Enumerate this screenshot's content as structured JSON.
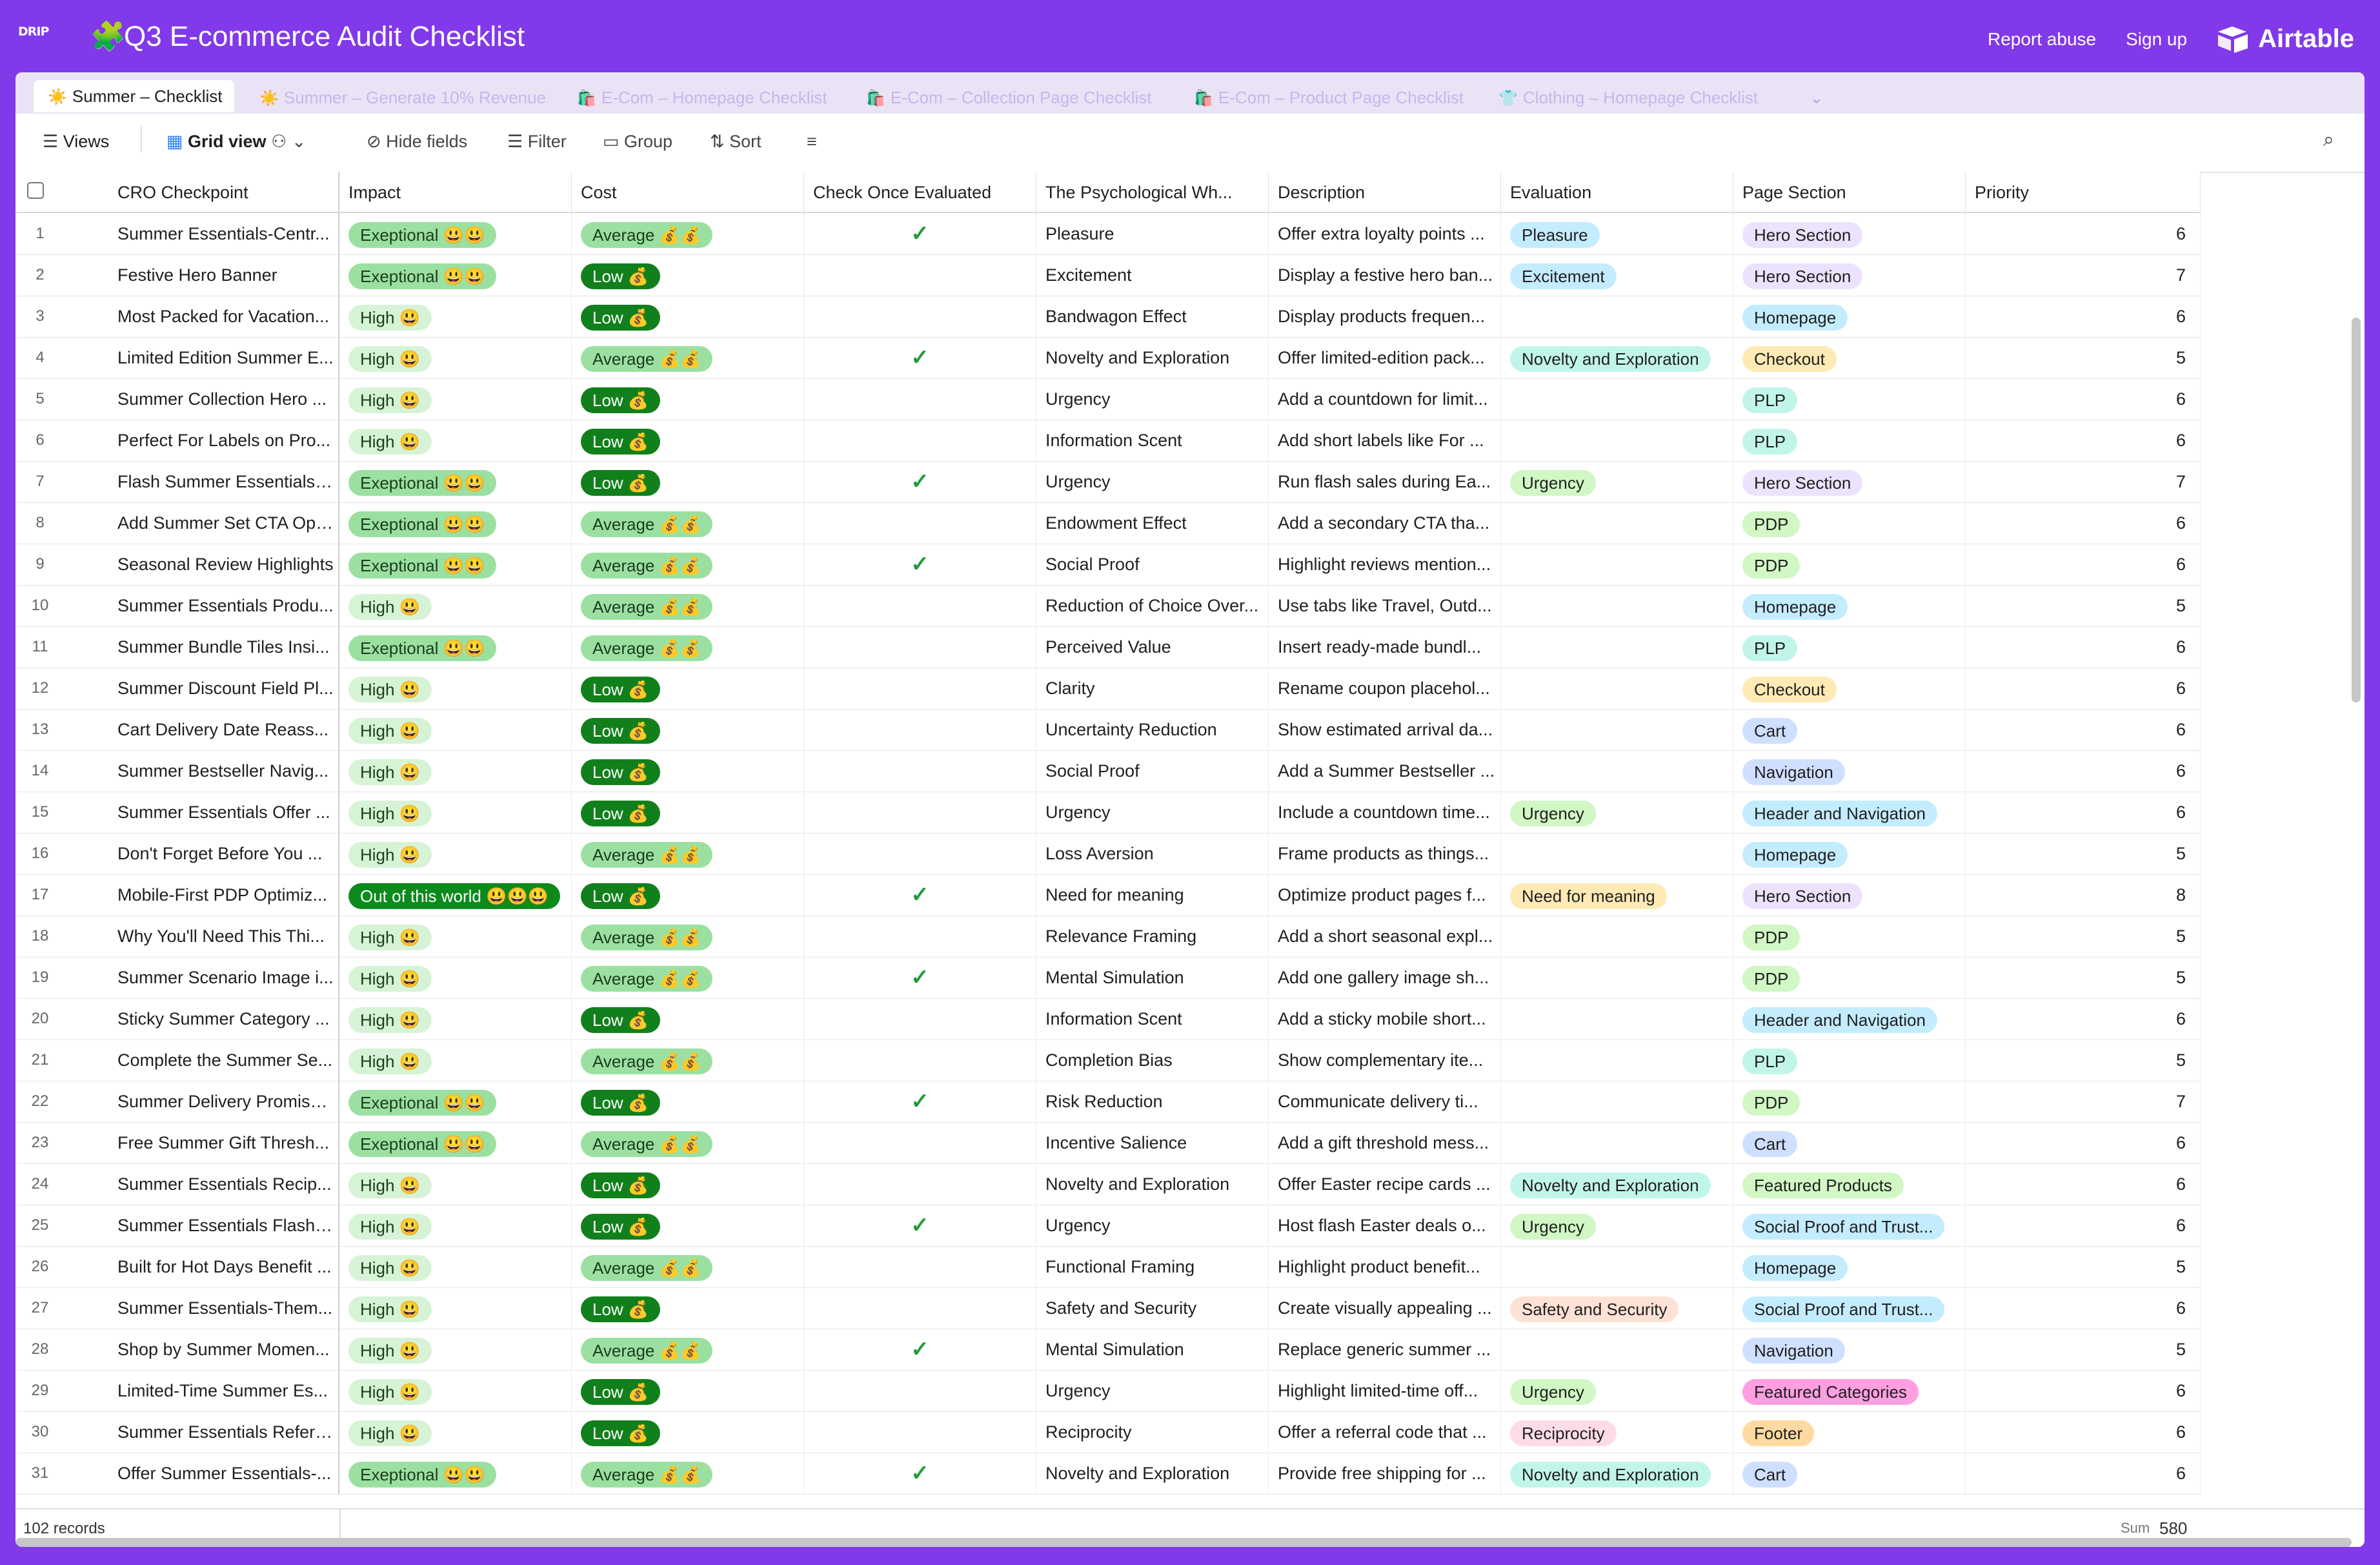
{
  "app": {
    "logo_text": "DRIP",
    "title_emoji": "🧩",
    "title": "Q3 E-commerce Audit Checklist",
    "report_abuse": "Report abuse",
    "sign_up": "Sign up",
    "brand": "Airtable"
  },
  "tabs": [
    {
      "icon": "☀️",
      "label": "Summer – Checklist",
      "active": true
    },
    {
      "icon": "☀️",
      "label": "Summer – Generate 10% Revenue"
    },
    {
      "icon": "🛍️",
      "label": "E-Com – Homepage Checklist"
    },
    {
      "icon": "🛍️",
      "label": "E-Com – Collection Page Checklist"
    },
    {
      "icon": "🛍️",
      "label": "E-Com – Product Page Checklist"
    },
    {
      "icon": "👕",
      "label": "Clothing – Homepage Checklist"
    }
  ],
  "toolbar": {
    "views": "Views",
    "grid_view": "Grid view",
    "hide_fields": "Hide fields",
    "filter": "Filter",
    "group": "Group",
    "sort": "Sort"
  },
  "columns": [
    "CRO Checkpoint",
    "Impact",
    "Cost",
    "Check Once Evaluated",
    "The Psychological Wh...",
    "Description",
    "Evaluation",
    "Page Section",
    "Priority"
  ],
  "colors": {
    "Pleasure": "#c4ecff",
    "Excitement": "#c4ecff",
    "Novelty and Exploration": "#c2f5e9",
    "Urgency": "#d1f7c4",
    "Need for meaning": "#ffeab6",
    "Safety and Security": "#fee2d5",
    "Reciprocity": "#ffdce5",
    "Hero Section": "#ede2fe",
    "Homepage": "#c4ecff",
    "Checkout": "#ffeab6",
    "PLP": "#c2f5e9",
    "PDP": "#d1f7c4",
    "Cart": "#cfdfff",
    "Navigation": "#cfdfff",
    "Header and Navigation": "#c4ecff",
    "Featured Products": "#d1f7c4",
    "Social Proof and Trust...": "#c4ecff",
    "Featured Categories": "#ff9ee0",
    "Footer": "#ffdaa0"
  },
  "rows": [
    {
      "n": "1",
      "cro": "Summer Essentials-Centr...",
      "impact": "Exeptional 😃😃",
      "ic": "exc",
      "cost": "Average 💰💰",
      "cc": "avg",
      "check": true,
      "psych": "Pleasure",
      "desc": "Offer extra loyalty points ...",
      "eval": "Pleasure",
      "section": "Hero Section",
      "priority": "6"
    },
    {
      "n": "2",
      "cro": "Festive Hero Banner",
      "impact": "Exeptional 😃😃",
      "ic": "exc",
      "cost": "Low 💰",
      "cc": "low",
      "check": false,
      "psych": "Excitement",
      "desc": "Display a festive hero ban...",
      "eval": "Excitement",
      "section": "Hero Section",
      "priority": "7"
    },
    {
      "n": "3",
      "cro": "Most Packed for Vacation...",
      "impact": "High 😃",
      "ic": "high",
      "cost": "Low 💰",
      "cc": "low",
      "check": false,
      "psych": "Bandwagon Effect",
      "desc": "Display products frequen...",
      "eval": "",
      "section": "Homepage",
      "priority": "6"
    },
    {
      "n": "4",
      "cro": "Limited Edition Summer E...",
      "impact": "High 😃",
      "ic": "high",
      "cost": "Average 💰💰",
      "cc": "avg",
      "check": true,
      "psych": "Novelty and Exploration",
      "desc": "Offer limited-edition pack...",
      "eval": "Novelty and Exploration",
      "section": "Checkout",
      "priority": "5"
    },
    {
      "n": "5",
      "cro": "Summer Collection Hero ...",
      "impact": "High 😃",
      "ic": "high",
      "cost": "Low 💰",
      "cc": "low",
      "check": false,
      "psych": "Urgency",
      "desc": "Add a countdown for limit...",
      "eval": "",
      "section": "PLP",
      "priority": "6"
    },
    {
      "n": "6",
      "cro": "Perfect For Labels on Pro...",
      "impact": "High 😃",
      "ic": "high",
      "cost": "Low 💰",
      "cc": "low",
      "check": false,
      "psych": "Information Scent",
      "desc": "Add short labels like For ...",
      "eval": "",
      "section": "PLP",
      "priority": "6"
    },
    {
      "n": "7",
      "cro": "Flash Summer Essentials ...",
      "impact": "Exeptional 😃😃",
      "ic": "exc",
      "cost": "Low 💰",
      "cc": "low",
      "check": true,
      "psych": "Urgency",
      "desc": "Run flash sales during Ea...",
      "eval": "Urgency",
      "section": "Hero Section",
      "priority": "7"
    },
    {
      "n": "8",
      "cro": "Add Summer Set CTA Opt...",
      "impact": "Exeptional 😃😃",
      "ic": "exc",
      "cost": "Average 💰💰",
      "cc": "avg",
      "check": false,
      "psych": "Endowment Effect",
      "desc": "Add a secondary CTA tha...",
      "eval": "",
      "section": "PDP",
      "priority": "6"
    },
    {
      "n": "9",
      "cro": "Seasonal Review Highlights",
      "impact": "Exeptional 😃😃",
      "ic": "exc",
      "cost": "Average 💰💰",
      "cc": "avg",
      "check": true,
      "psych": "Social Proof",
      "desc": "Highlight reviews mention...",
      "eval": "",
      "section": "PDP",
      "priority": "6"
    },
    {
      "n": "10",
      "cro": "Summer Essentials Produ...",
      "impact": "High 😃",
      "ic": "high",
      "cost": "Average 💰💰",
      "cc": "avg",
      "check": false,
      "psych": "Reduction of Choice Over...",
      "desc": "Use tabs like Travel, Outd...",
      "eval": "",
      "section": "Homepage",
      "priority": "5"
    },
    {
      "n": "11",
      "cro": "Summer Bundle Tiles Insi...",
      "impact": "Exeptional 😃😃",
      "ic": "exc",
      "cost": "Average 💰💰",
      "cc": "avg",
      "check": false,
      "psych": "Perceived Value",
      "desc": "Insert ready-made bundl...",
      "eval": "",
      "section": "PLP",
      "priority": "6"
    },
    {
      "n": "12",
      "cro": "Summer Discount Field Pl...",
      "impact": "High 😃",
      "ic": "high",
      "cost": "Low 💰",
      "cc": "low",
      "check": false,
      "psych": "Clarity",
      "desc": "Rename coupon placehol...",
      "eval": "",
      "section": "Checkout",
      "priority": "6"
    },
    {
      "n": "13",
      "cro": "Cart Delivery Date Reass...",
      "impact": "High 😃",
      "ic": "high",
      "cost": "Low 💰",
      "cc": "low",
      "check": false,
      "psych": "Uncertainty Reduction",
      "desc": "Show estimated arrival da...",
      "eval": "",
      "section": "Cart",
      "priority": "6"
    },
    {
      "n": "14",
      "cro": "Summer Bestseller Navig...",
      "impact": "High 😃",
      "ic": "high",
      "cost": "Low 💰",
      "cc": "low",
      "check": false,
      "psych": "Social Proof",
      "desc": "Add a Summer Bestseller ...",
      "eval": "",
      "section": "Navigation",
      "priority": "6"
    },
    {
      "n": "15",
      "cro": "Summer Essentials Offer ...",
      "impact": "High 😃",
      "ic": "high",
      "cost": "Low 💰",
      "cc": "low",
      "check": false,
      "psych": "Urgency",
      "desc": "Include a countdown time...",
      "eval": "Urgency",
      "section": "Header and Navigation",
      "priority": "6"
    },
    {
      "n": "16",
      "cro": "Don't Forget Before You ...",
      "impact": "High 😃",
      "ic": "high",
      "cost": "Average 💰💰",
      "cc": "avg",
      "check": false,
      "psych": "Loss Aversion",
      "desc": "Frame products as things...",
      "eval": "",
      "section": "Homepage",
      "priority": "5"
    },
    {
      "n": "17",
      "cro": "Mobile-First PDP Optimiz...",
      "impact": "Out of this world 😃😃😃",
      "ic": "out",
      "cost": "Low 💰",
      "cc": "low",
      "check": true,
      "psych": "Need for meaning",
      "desc": "Optimize product pages f...",
      "eval": "Need for meaning",
      "section": "Hero Section",
      "priority": "8"
    },
    {
      "n": "18",
      "cro": "Why You'll Need This Thi...",
      "impact": "High 😃",
      "ic": "high",
      "cost": "Average 💰💰",
      "cc": "avg",
      "check": false,
      "psych": "Relevance Framing",
      "desc": "Add a short seasonal expl...",
      "eval": "",
      "section": "PDP",
      "priority": "5"
    },
    {
      "n": "19",
      "cro": "Summer Scenario Image i...",
      "impact": "High 😃",
      "ic": "high",
      "cost": "Average 💰💰",
      "cc": "avg",
      "check": true,
      "psych": "Mental Simulation",
      "desc": "Add one gallery image sh...",
      "eval": "",
      "section": "PDP",
      "priority": "5"
    },
    {
      "n": "20",
      "cro": "Sticky Summer Category ...",
      "impact": "High 😃",
      "ic": "high",
      "cost": "Low 💰",
      "cc": "low",
      "check": false,
      "psych": "Information Scent",
      "desc": "Add a sticky mobile short...",
      "eval": "",
      "section": "Header and Navigation",
      "priority": "6"
    },
    {
      "n": "21",
      "cro": "Complete the Summer Se...",
      "impact": "High 😃",
      "ic": "high",
      "cost": "Average 💰💰",
      "cc": "avg",
      "check": false,
      "psych": "Completion Bias",
      "desc": "Show complementary ite...",
      "eval": "",
      "section": "PLP",
      "priority": "5"
    },
    {
      "n": "22",
      "cro": "Summer Delivery Promise...",
      "impact": "Exeptional 😃😃",
      "ic": "exc",
      "cost": "Low 💰",
      "cc": "low",
      "check": true,
      "psych": "Risk Reduction",
      "desc": "Communicate delivery ti...",
      "eval": "",
      "section": "PDP",
      "priority": "7"
    },
    {
      "n": "23",
      "cro": "Free Summer Gift Thresh...",
      "impact": "Exeptional 😃😃",
      "ic": "exc",
      "cost": "Average 💰💰",
      "cc": "avg",
      "check": false,
      "psych": "Incentive Salience",
      "desc": "Add a gift threshold mess...",
      "eval": "",
      "section": "Cart",
      "priority": "6"
    },
    {
      "n": "24",
      "cro": "Summer Essentials Recip...",
      "impact": "High 😃",
      "ic": "high",
      "cost": "Low 💰",
      "cc": "low",
      "check": false,
      "psych": "Novelty and Exploration",
      "desc": "Offer Easter recipe cards ...",
      "eval": "Novelty and Exploration",
      "section": "Featured Products",
      "priority": "6"
    },
    {
      "n": "25",
      "cro": "Summer Essentials Flash ...",
      "impact": "High 😃",
      "ic": "high",
      "cost": "Low 💰",
      "cc": "low",
      "check": true,
      "psych": "Urgency",
      "desc": "Host flash Easter deals o...",
      "eval": "Urgency",
      "section": "Social Proof and Trust...",
      "priority": "6"
    },
    {
      "n": "26",
      "cro": "Built for Hot Days Benefit ...",
      "impact": "High 😃",
      "ic": "high",
      "cost": "Average 💰💰",
      "cc": "avg",
      "check": false,
      "psych": "Functional Framing",
      "desc": "Highlight product benefit...",
      "eval": "",
      "section": "Homepage",
      "priority": "5"
    },
    {
      "n": "27",
      "cro": "Summer Essentials-Them...",
      "impact": "High 😃",
      "ic": "high",
      "cost": "Low 💰",
      "cc": "low",
      "check": false,
      "psych": "Safety and Security",
      "desc": "Create visually appealing ...",
      "eval": "Safety and Security",
      "section": "Social Proof and Trust...",
      "priority": "6"
    },
    {
      "n": "28",
      "cro": "Shop by Summer Momen...",
      "impact": "High 😃",
      "ic": "high",
      "cost": "Average 💰💰",
      "cc": "avg",
      "check": true,
      "psych": "Mental Simulation",
      "desc": "Replace generic summer ...",
      "eval": "",
      "section": "Navigation",
      "priority": "5"
    },
    {
      "n": "29",
      "cro": "Limited-Time Summer Es...",
      "impact": "High 😃",
      "ic": "high",
      "cost": "Low 💰",
      "cc": "low",
      "check": false,
      "psych": "Urgency",
      "desc": "Highlight limited-time off...",
      "eval": "Urgency",
      "section": "Featured Categories",
      "priority": "6"
    },
    {
      "n": "30",
      "cro": "Summer Essentials Referr...",
      "impact": "High 😃",
      "ic": "high",
      "cost": "Low 💰",
      "cc": "low",
      "check": false,
      "psych": "Reciprocity",
      "desc": "Offer a referral code that ...",
      "eval": "Reciprocity",
      "section": "Footer",
      "priority": "6"
    },
    {
      "n": "31",
      "cro": "Offer Summer Essentials-...",
      "impact": "Exeptional 😃😃",
      "ic": "exc",
      "cost": "Average 💰💰",
      "cc": "avg",
      "check": true,
      "psych": "Novelty and Exploration",
      "desc": "Provide free shipping for ...",
      "eval": "Novelty and Exploration",
      "section": "Cart",
      "priority": "6"
    }
  ],
  "footer": {
    "records": "102 records",
    "sum_label": "Sum",
    "sum_value": "580"
  }
}
